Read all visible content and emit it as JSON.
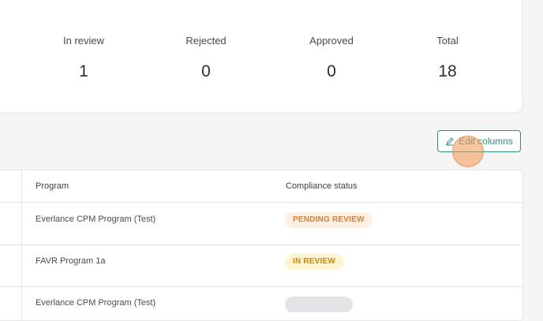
{
  "stats": [
    {
      "label": "In review",
      "value": "1"
    },
    {
      "label": "Rejected",
      "value": "0"
    },
    {
      "label": "Approved",
      "value": "0"
    },
    {
      "label": "Total",
      "value": "18"
    }
  ],
  "toolbar": {
    "edit_columns_label": "Edit columns",
    "edit_icon": "pencil-icon"
  },
  "table": {
    "columns": [
      "Program",
      "Compliance status"
    ],
    "rows": [
      {
        "program": "Everlance CPM Program (Test)",
        "status": "PENDING REVIEW"
      },
      {
        "program": "FAVR Program 1a",
        "status": "IN REVIEW"
      },
      {
        "program": "Everlance CPM Program (Test)",
        "status": ""
      }
    ]
  },
  "colors": {
    "accent": "#2f8f83",
    "pending_bg": "#fdf0e2",
    "pending_text": "#d5803a",
    "review_bg": "#fff4cf",
    "review_text": "#c98a10",
    "click_indicator": "#f0a060"
  }
}
